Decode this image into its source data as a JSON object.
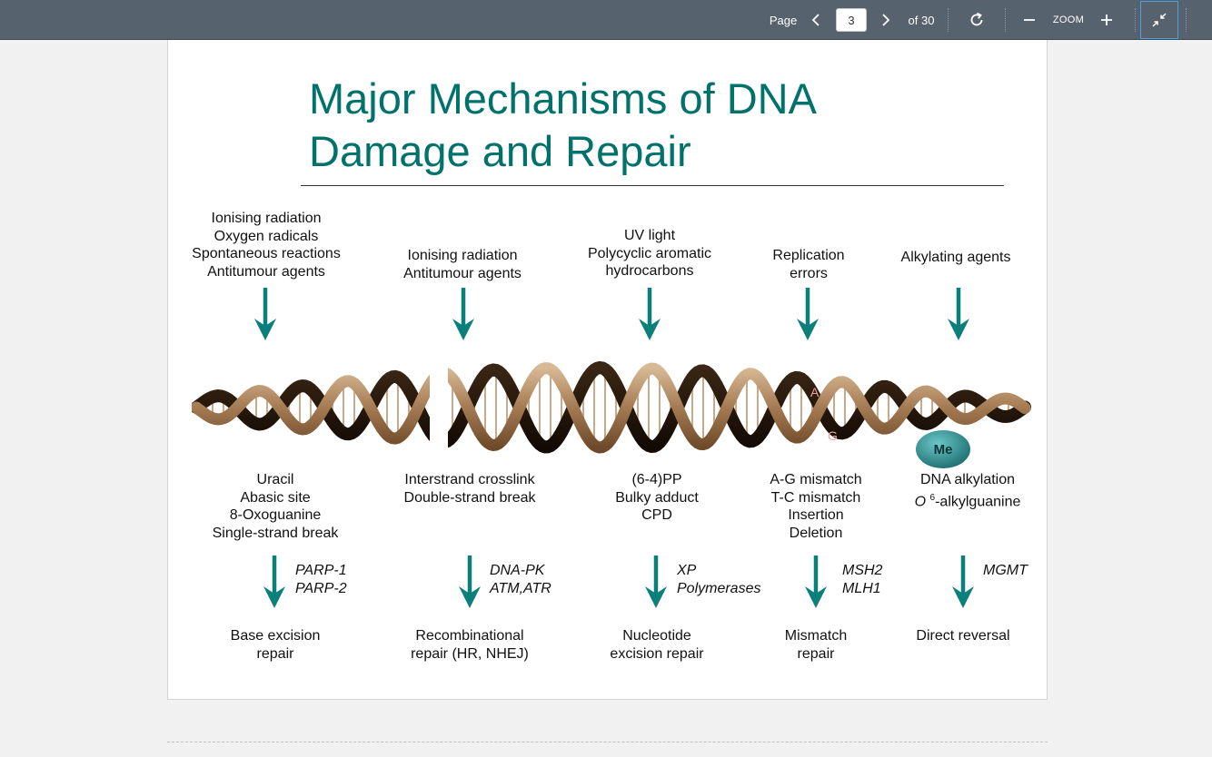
{
  "toolbar": {
    "page_label": "Page",
    "current_page": "3",
    "page_total": "of 30",
    "zoom_label": "ZOOM",
    "icons": [
      "chevron-left-icon",
      "chevron-right-icon",
      "rotate-icon",
      "minus-icon",
      "plus-icon",
      "exit-fullscreen-icon"
    ]
  },
  "slide": {
    "title_line1": "Major Mechanisms of DNA",
    "title_line2": "Damage and Repair",
    "colors": {
      "title": "#00716b",
      "arrow": "#0b7f7a",
      "helix": "#a8835f",
      "methyl": "#2e8f92"
    },
    "helix_labels": {
      "base_a": "A",
      "base_g": "G",
      "methyl": "Me"
    },
    "columns": [
      {
        "agents": [
          "Ionising radiation",
          "Oxygen radicals",
          "Spontaneous reactions",
          "Antitumour agents"
        ],
        "lesions": [
          "Uracil",
          "Abasic site",
          "8-Oxoguanine",
          "Single-strand break"
        ],
        "enzymes": [
          "PARP-1",
          "PARP-2"
        ],
        "pathway": [
          "Base excision",
          "repair"
        ]
      },
      {
        "agents": [
          "Ionising radiation",
          "Antitumour agents"
        ],
        "lesions": [
          "Interstrand crosslink",
          "Double-strand break"
        ],
        "enzymes": [
          "DNA-PK",
          "ATM,ATR"
        ],
        "pathway": [
          "Recombinational",
          "repair (HR, NHEJ)"
        ]
      },
      {
        "agents": [
          "UV light",
          "Polycyclic aromatic",
          "hydrocarbons"
        ],
        "lesions": [
          "(6-4)PP",
          "Bulky adduct",
          "CPD"
        ],
        "enzymes": [
          "XP",
          "Polymerases"
        ],
        "pathway": [
          "Nucleotide",
          "excision repair"
        ]
      },
      {
        "agents": [
          "Replication",
          "errors"
        ],
        "lesions": [
          "A-G mismatch",
          "T-C mismatch",
          "Insertion",
          "Deletion"
        ],
        "enzymes": [
          "MSH2",
          "MLH1"
        ],
        "pathway": [
          "Mismatch",
          "repair"
        ]
      },
      {
        "agents": [
          "Alkylating agents"
        ],
        "lesions": [
          "DNA alkylation",
          "-alkylguanine"
        ],
        "lesion_o6_prefix": "O",
        "lesion_o6_sup": "6",
        "enzymes": [
          "MGMT"
        ],
        "pathway": [
          "Direct reversal"
        ]
      }
    ]
  }
}
